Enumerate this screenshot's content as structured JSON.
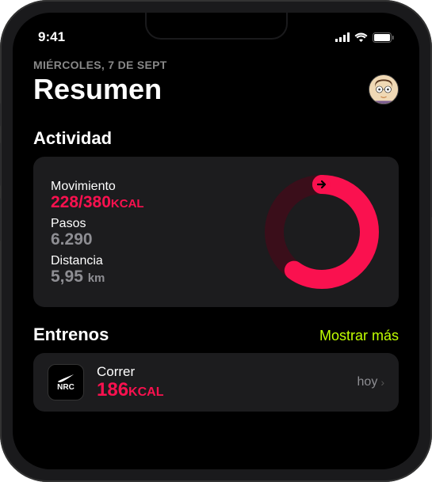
{
  "status_bar": {
    "time": "9:41"
  },
  "header": {
    "date_label": "MIÉRCOLES, 7 DE SEPT",
    "title": "Resumen"
  },
  "activity": {
    "section_title": "Actividad",
    "move": {
      "label": "Movimiento",
      "value": "228/380",
      "unit": "KCAL"
    },
    "steps": {
      "label": "Pasos",
      "value": "6.290"
    },
    "distance": {
      "label": "Distancia",
      "value": "5,95",
      "unit": "km"
    },
    "ring": {
      "progress_percent": 60
    }
  },
  "workouts": {
    "section_title": "Entrenos",
    "show_more": "Mostrar más",
    "items": [
      {
        "app_label": "NRC",
        "name": "Correr",
        "value": "186",
        "unit": "KCAL",
        "time_label": "hoy"
      }
    ]
  },
  "colors": {
    "move_ring": "#fa114f",
    "accent_lime": "#c0ff00",
    "card_bg": "#1c1c1e"
  }
}
